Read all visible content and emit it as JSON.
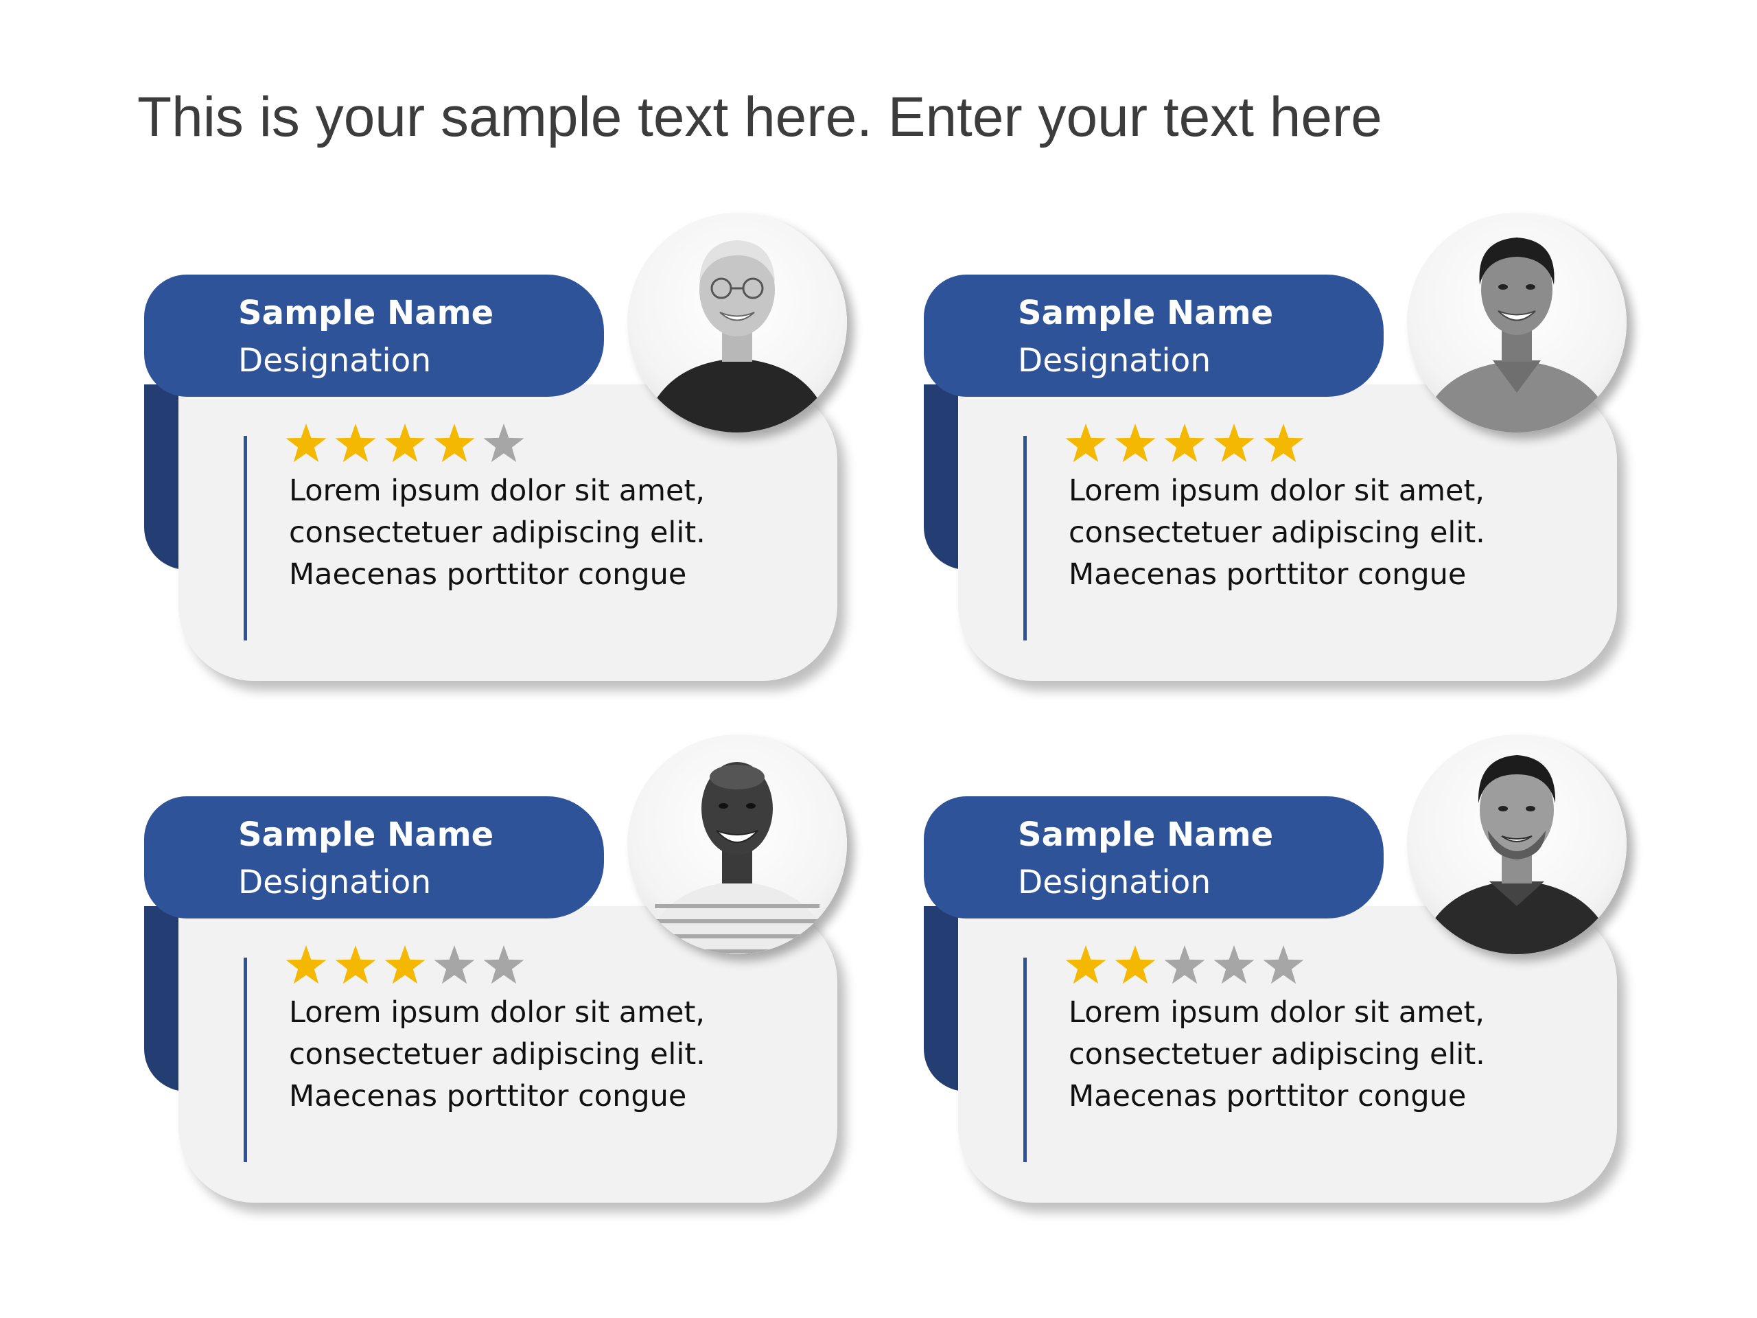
{
  "page": {
    "title": "This is your sample text here. Enter your text here"
  },
  "colors": {
    "tab_blue": "#2e5399",
    "fold_dark_blue": "#243d72",
    "card_background": "#f2f2f2",
    "star_filled": "#f5b800",
    "star_empty": "#a6a6a6",
    "title_text": "#3c3c3c"
  },
  "testimonials": [
    {
      "name": "Sample Name",
      "designation": "Designation",
      "rating": 4,
      "rating_max": 5,
      "quote_lines": [
        "Lorem ipsum dolor sit amet,",
        "consectetuer adipiscing elit.",
        "Maecenas porttitor congue"
      ],
      "avatar_icon": "person-photo-icon"
    },
    {
      "name": "Sample Name",
      "designation": "Designation",
      "rating": 5,
      "rating_max": 5,
      "quote_lines": [
        "Lorem ipsum dolor sit amet,",
        "consectetuer adipiscing elit.",
        "Maecenas porttitor congue"
      ],
      "avatar_icon": "person-photo-icon"
    },
    {
      "name": "Sample Name",
      "designation": "Designation",
      "rating": 3,
      "rating_max": 5,
      "quote_lines": [
        "Lorem ipsum dolor sit amet,",
        "consectetuer adipiscing elit.",
        "Maecenas porttitor congue"
      ],
      "avatar_icon": "person-photo-icon"
    },
    {
      "name": "Sample Name",
      "designation": "Designation",
      "rating": 2,
      "rating_max": 5,
      "quote_lines": [
        "Lorem ipsum dolor sit amet,",
        "consectetuer adipiscing elit.",
        "Maecenas porttitor congue"
      ],
      "avatar_icon": "person-photo-icon"
    }
  ]
}
